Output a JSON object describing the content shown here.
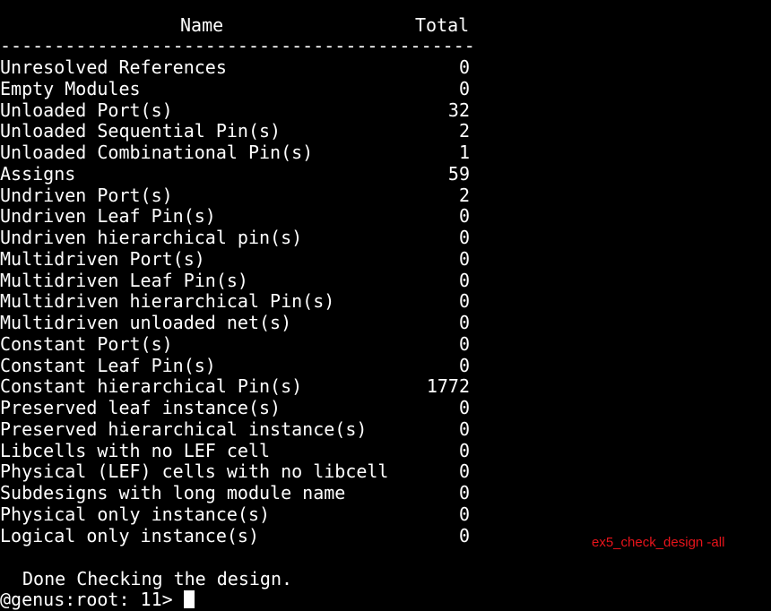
{
  "header": {
    "name": "Name",
    "total": "Total",
    "separator": "--------------------------------------------"
  },
  "rows": [
    {
      "label": "Unresolved References",
      "value": "0"
    },
    {
      "label": "Empty Modules",
      "value": "0"
    },
    {
      "label": "Unloaded Port(s)",
      "value": "32"
    },
    {
      "label": "Unloaded Sequential Pin(s)",
      "value": "2"
    },
    {
      "label": "Unloaded Combinational Pin(s)",
      "value": "1"
    },
    {
      "label": "Assigns",
      "value": "59"
    },
    {
      "label": "Undriven Port(s)",
      "value": "2"
    },
    {
      "label": "Undriven Leaf Pin(s)",
      "value": "0"
    },
    {
      "label": "Undriven hierarchical pin(s)",
      "value": "0"
    },
    {
      "label": "Multidriven Port(s)",
      "value": "0"
    },
    {
      "label": "Multidriven Leaf Pin(s)",
      "value": "0"
    },
    {
      "label": "Multidriven hierarchical Pin(s)",
      "value": "0"
    },
    {
      "label": "Multidriven unloaded net(s)",
      "value": "0"
    },
    {
      "label": "Constant Port(s)",
      "value": "0"
    },
    {
      "label": "Constant Leaf Pin(s)",
      "value": "0"
    },
    {
      "label": "Constant hierarchical Pin(s)",
      "value": "1772"
    },
    {
      "label": "Preserved leaf instance(s)",
      "value": "0"
    },
    {
      "label": "Preserved hierarchical instance(s)",
      "value": "0"
    },
    {
      "label": "Libcells with no LEF cell",
      "value": "0"
    },
    {
      "label": "Physical (LEF) cells with no libcell",
      "value": "0"
    },
    {
      "label": "Subdesigns with long module name",
      "value": "0"
    },
    {
      "label": "Physical only instance(s)",
      "value": "0"
    },
    {
      "label": "Logical only instance(s)",
      "value": "0"
    }
  ],
  "footer": {
    "done_message": "Done Checking the design.",
    "prompt": "@genus:root: 11> "
  },
  "annotation": {
    "text": "ex5_check_design -all",
    "color": "#e8141b"
  },
  "colors": {
    "background": "#000000",
    "foreground": "#ffffff"
  }
}
